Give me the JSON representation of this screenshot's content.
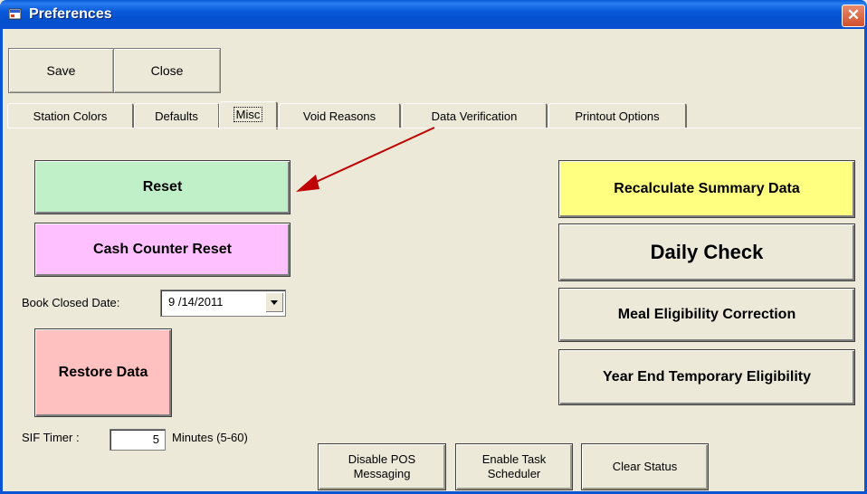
{
  "window": {
    "title": "Preferences",
    "close_symbol": "✕"
  },
  "toolbar": {
    "save_label": "Save",
    "close_label": "Close"
  },
  "tabs": [
    {
      "label": "Station Colors"
    },
    {
      "label": "Defaults"
    },
    {
      "label": "Misc"
    },
    {
      "label": "Void Reasons"
    },
    {
      "label": "Data Verification"
    },
    {
      "label": "Printout Options"
    }
  ],
  "misc": {
    "reset_label": "Reset",
    "cash_counter_reset_label": "Cash Counter Reset",
    "book_closed_label": "Book Closed Date:",
    "book_closed_value": "9 /14/2011",
    "restore_label": "Restore Data",
    "sif_timer_label": "SIF Timer :",
    "sif_timer_value": "5",
    "sif_units_label": "Minutes  (5-60)",
    "recalc_label": "Recalculate Summary Data",
    "daily_check_label": "Daily Check",
    "meal_eligibility_label": "Meal Eligibility Correction",
    "year_end_label": "Year End Temporary Eligibility",
    "disable_pos_label": "Disable POS Messaging",
    "enable_task_label": "Enable Task Scheduler",
    "clear_status_label": "Clear Status"
  },
  "colors": {
    "reset_bg": "#c0f0c8",
    "cash_reset_bg": "#ffc0ff",
    "restore_bg": "#ffc0c0",
    "recalc_bg": "#ffff80",
    "annotation_arrow": "#c00000"
  }
}
